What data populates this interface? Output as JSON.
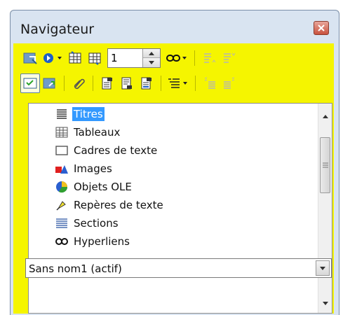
{
  "window": {
    "title": "Navigateur"
  },
  "toolbar": {
    "page_number": "1",
    "buttons1": [
      "toggle-content-view-icon",
      "navigation-icon",
      "previous-table-icon",
      "next-table-icon",
      "spin",
      "drag-mode-icon",
      "promote-level-icon",
      "demote-level-icon"
    ],
    "buttons2": [
      "content-navigation-view-icon",
      "list-box-icon",
      "set-reminder-icon",
      "header-icon",
      "footer-icon",
      "anchor-text-icon",
      "heading-levels-icon",
      "promote-chapter-icon",
      "demote-chapter-icon"
    ]
  },
  "tree": {
    "items": [
      {
        "label": "Titres",
        "icon": "headings-icon",
        "selected": true
      },
      {
        "label": "Tableaux",
        "icon": "table-icon"
      },
      {
        "label": "Cadres de texte",
        "icon": "text-frame-icon"
      },
      {
        "label": "Images",
        "icon": "images-icon"
      },
      {
        "label": "Objets OLE",
        "icon": "ole-object-icon"
      },
      {
        "label": "Repères de texte",
        "icon": "bookmark-icon"
      },
      {
        "label": "Sections",
        "icon": "sections-icon"
      },
      {
        "label": "Hyperliens",
        "icon": "hyperlink-icon"
      }
    ]
  },
  "document_select": {
    "value": "Sans nom1 (actif)"
  },
  "colors": {
    "panel": "#f5f500",
    "selection": "#3399ff",
    "window": "#d9e4f1"
  }
}
